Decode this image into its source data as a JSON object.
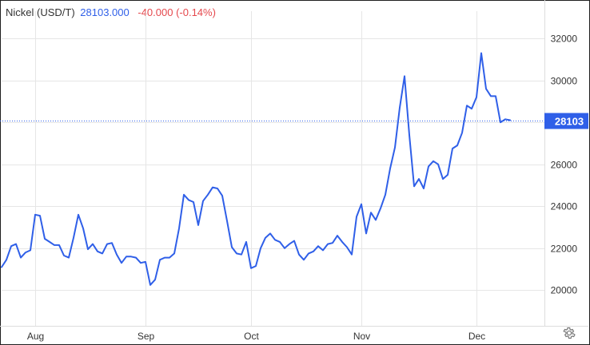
{
  "header": {
    "instrument": "Nickel (USD/T)",
    "price": "28103.000",
    "change": "-40.000 (-0.14%)"
  },
  "colors": {
    "line": "#2f5fe8",
    "change_negative": "#e5484d",
    "grid": "#e6e6e6",
    "badge_bg": "#2f5fe8",
    "badge_text": "#ffffff"
  },
  "icons": {
    "settings": "gear-icon"
  },
  "chart_data": {
    "type": "line",
    "title": "Nickel (USD/T)",
    "ylim": [
      18300,
      33300
    ],
    "yticks": [
      20000,
      22000,
      24000,
      26000,
      28000,
      30000,
      32000
    ],
    "ytick_labels": [
      "20000",
      "22000",
      "24000",
      "26000",
      "28000",
      "30000",
      "32000"
    ],
    "x_tick_labels": [
      "Aug",
      "Sep",
      "Oct",
      "Nov",
      "Dec"
    ],
    "x_tick_index": [
      7,
      30,
      52,
      75,
      99
    ],
    "last_value_label": "28103",
    "last_value": 28103,
    "grid": true,
    "series": [
      {
        "values": [
          21100,
          21450,
          22100,
          22200,
          21550,
          21800,
          21900,
          23600,
          23550,
          22450,
          22300,
          22150,
          22150,
          21650,
          21550,
          22500,
          23600,
          22950,
          21950,
          22200,
          21850,
          21750,
          22200,
          22250,
          21700,
          21300,
          21600,
          21600,
          21550,
          21300,
          21350,
          20250,
          20500,
          21450,
          21550,
          21550,
          21750,
          22950,
          24550,
          24300,
          24200,
          23100,
          24250,
          24550,
          24900,
          24850,
          24500,
          23300,
          22050,
          21750,
          21700,
          22300,
          21050,
          21150,
          22000,
          22500,
          22700,
          22400,
          22300,
          22000,
          22200,
          22350,
          21700,
          21450,
          21750,
          21850,
          22100,
          21900,
          22200,
          22250,
          22600,
          22300,
          22050,
          21700,
          23500,
          24100,
          22700,
          23700,
          23350,
          23900,
          24550,
          25800,
          26800,
          28700,
          30200,
          27400,
          24950,
          25300,
          24850,
          25900,
          26150,
          26000,
          25300,
          25500,
          26750,
          26900,
          27500,
          28800,
          28650,
          29200,
          31300,
          29600,
          29250,
          29250,
          28000,
          28150,
          28103
        ]
      }
    ]
  }
}
